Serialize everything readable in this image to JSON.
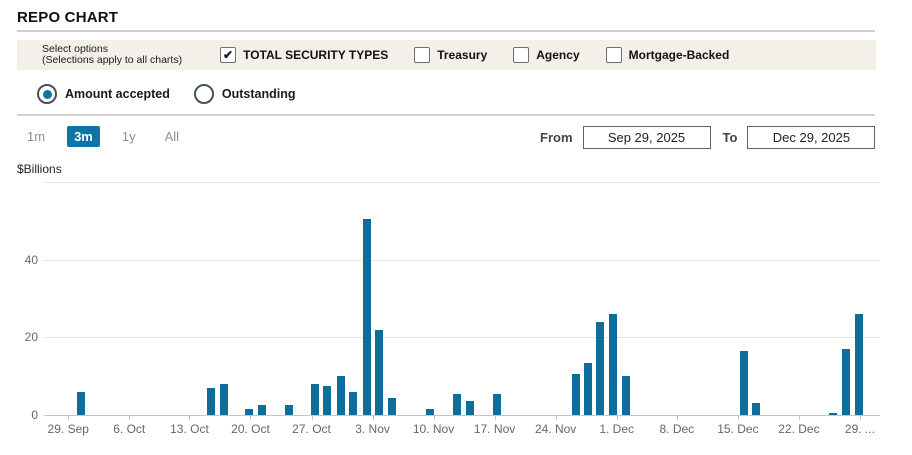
{
  "page": {
    "title": "REPO CHART"
  },
  "options_bar": {
    "caption_line1": "Select options",
    "caption_line2": "(Selections apply to all charts)",
    "checkboxes": [
      {
        "label": "TOTAL SECURITY TYPES",
        "checked": true
      },
      {
        "label": "Treasury",
        "checked": false
      },
      {
        "label": "Agency",
        "checked": false
      },
      {
        "label": "Mortgage-Backed",
        "checked": false
      }
    ]
  },
  "series_toggle": [
    {
      "label": "Amount accepted",
      "selected": true
    },
    {
      "label": "Outstanding",
      "selected": false
    }
  ],
  "range_buttons": [
    {
      "label": "1m",
      "active": false
    },
    {
      "label": "3m",
      "active": true
    },
    {
      "label": "1y",
      "active": false
    },
    {
      "label": "All",
      "active": false
    }
  ],
  "date_range": {
    "from_label": "From",
    "from_value": "Sep 29, 2025",
    "to_label": "To",
    "to_value": "Dec 29, 2025"
  },
  "colors": {
    "accent_blue": "#0e74a4",
    "bar_blue": "#0d6e9c",
    "options_bar_bg": "#f4f0e9",
    "gridline": "#e6e6e6",
    "axis_text": "#666666"
  },
  "chart_data": {
    "type": "bar",
    "title": "",
    "ylabel": "$Billions",
    "xlabel": "",
    "ylim": [
      0,
      60
    ],
    "yticks": [
      0,
      20,
      40
    ],
    "grid": true,
    "legend": "none",
    "x_ticks": [
      {
        "label": "29. Sep",
        "pos": 2.9
      },
      {
        "label": "6. Oct",
        "pos": 10.2
      },
      {
        "label": "13. Oct",
        "pos": 17.4
      },
      {
        "label": "20. Oct",
        "pos": 24.7
      },
      {
        "label": "27. Oct",
        "pos": 32.0
      },
      {
        "label": "3. Nov",
        "pos": 39.3
      },
      {
        "label": "10. Nov",
        "pos": 46.6
      },
      {
        "label": "17. Nov",
        "pos": 53.9
      },
      {
        "label": "24. Nov",
        "pos": 61.2
      },
      {
        "label": "1. Dec",
        "pos": 68.5
      },
      {
        "label": "8. Dec",
        "pos": 75.7
      },
      {
        "label": "15. Dec",
        "pos": 83.0
      },
      {
        "label": "22. Dec",
        "pos": 90.3
      },
      {
        "label": "29. ...",
        "pos": 97.6
      }
    ],
    "bars": [
      {
        "date": "Sep 30",
        "value": 6,
        "pos": 4.4
      },
      {
        "date": "Oct 15",
        "value": 7,
        "pos": 20.0
      },
      {
        "date": "Oct 16",
        "value": 8,
        "pos": 21.5
      },
      {
        "date": "Oct 20",
        "value": 1.5,
        "pos": 24.5
      },
      {
        "date": "Oct 21",
        "value": 2.5,
        "pos": 26.1
      },
      {
        "date": "Oct 24",
        "value": 2.5,
        "pos": 29.3
      },
      {
        "date": "Oct 27",
        "value": 8,
        "pos": 32.4
      },
      {
        "date": "Oct 28",
        "value": 7.5,
        "pos": 33.9
      },
      {
        "date": "Oct 29",
        "value": 10,
        "pos": 35.5
      },
      {
        "date": "Oct 30",
        "value": 6,
        "pos": 37.0
      },
      {
        "date": "Oct 31",
        "value": 50.5,
        "pos": 38.6
      },
      {
        "date": "Nov 3",
        "value": 22,
        "pos": 40.1
      },
      {
        "date": "Nov 4",
        "value": 4.5,
        "pos": 41.6
      },
      {
        "date": "Nov 10",
        "value": 1.5,
        "pos": 46.2
      },
      {
        "date": "Nov 12",
        "value": 5.5,
        "pos": 49.4
      },
      {
        "date": "Nov 13",
        "value": 3.5,
        "pos": 50.9
      },
      {
        "date": "Nov 17",
        "value": 5.5,
        "pos": 54.2
      },
      {
        "date": "Nov 25",
        "value": 10.5,
        "pos": 63.6
      },
      {
        "date": "Nov 26",
        "value": 13.5,
        "pos": 65.1
      },
      {
        "date": "Nov 28",
        "value": 24,
        "pos": 66.5
      },
      {
        "date": "Dec 1",
        "value": 26,
        "pos": 68.1
      },
      {
        "date": "Dec 2",
        "value": 10,
        "pos": 69.6
      },
      {
        "date": "Dec 15",
        "value": 16.5,
        "pos": 83.7
      },
      {
        "date": "Dec 16",
        "value": 3,
        "pos": 85.2
      },
      {
        "date": "Dec 24",
        "value": 0.5,
        "pos": 94.4
      },
      {
        "date": "Dec 26",
        "value": 17,
        "pos": 95.9
      },
      {
        "date": "Dec 29",
        "value": 26,
        "pos": 97.5
      }
    ]
  }
}
